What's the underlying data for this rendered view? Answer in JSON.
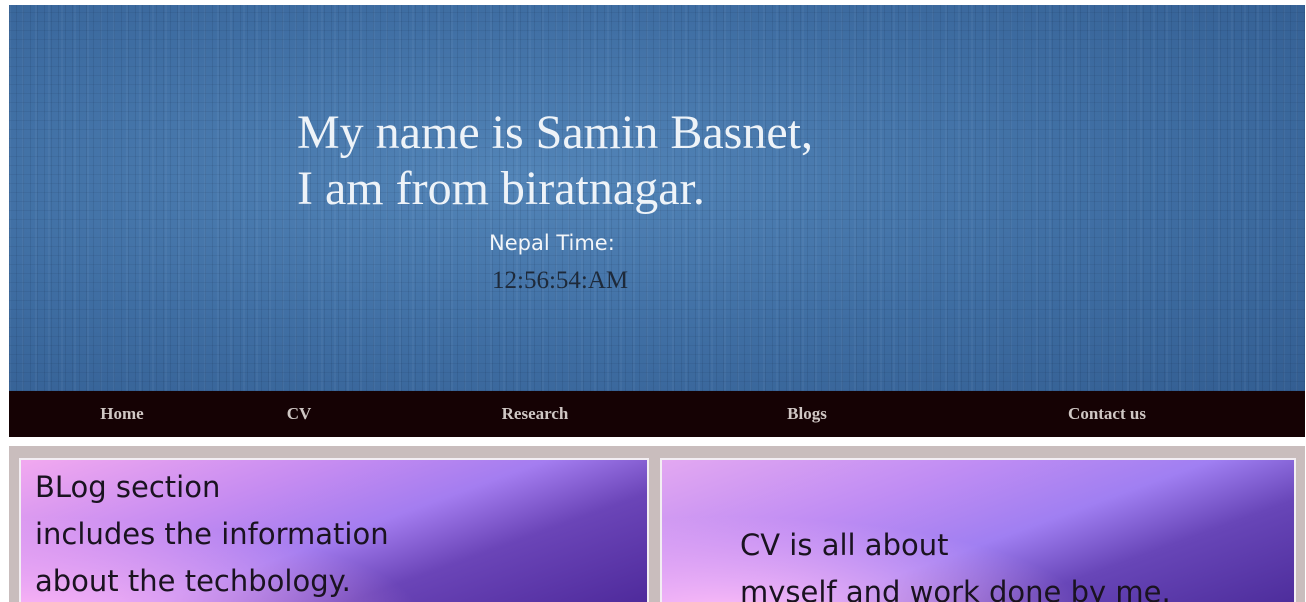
{
  "hero": {
    "title_lines": [
      "My name is Samin Basnet,",
      "I am from biratnagar."
    ],
    "time_label": "Nepal Time:",
    "time_value": "12:56:54:AM"
  },
  "nav": {
    "items": [
      {
        "label": "Home"
      },
      {
        "label": "CV"
      },
      {
        "label": "Research"
      },
      {
        "label": "Blogs"
      },
      {
        "label": "Contact us"
      }
    ]
  },
  "cards": [
    {
      "lines": [
        "BLog section",
        "includes the information",
        "about the techbology."
      ]
    },
    {
      "lines": [
        "CV is all about",
        "myself and work done by me."
      ]
    }
  ],
  "colors": {
    "hero_blue": "#3f6ea3",
    "nav_background": "#150204",
    "nav_text": "#cfc7c4",
    "content_background": "#c9bdbd",
    "card_purple": "#6b45b8"
  }
}
